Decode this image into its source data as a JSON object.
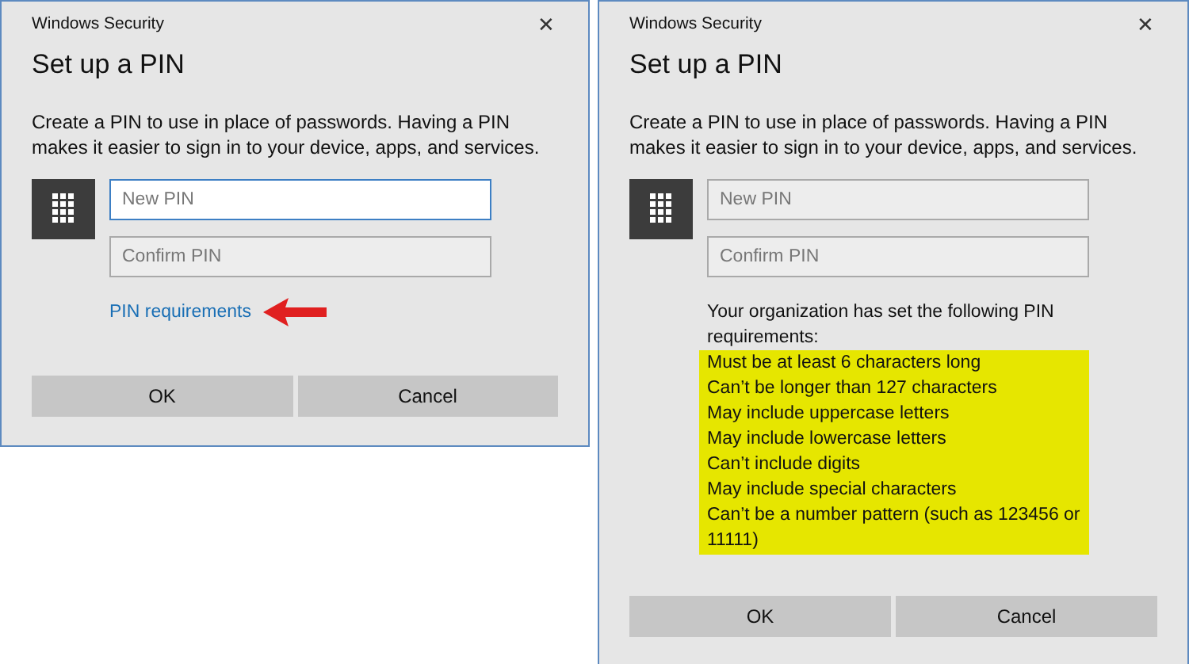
{
  "dialogs": [
    {
      "window_title": "Windows Security",
      "heading": "Set up a PIN",
      "description": "Create a PIN to use in place of passwords. Having a PIN makes it easier to sign in to your device, apps, and services.",
      "close": "✕",
      "fields": [
        {
          "placeholder": "New PIN",
          "focused": true
        },
        {
          "placeholder": "Confirm PIN",
          "focused": false
        }
      ],
      "link": {
        "label": "PIN requirements",
        "annotated": true
      },
      "buttons": [
        "OK",
        "Cancel"
      ]
    },
    {
      "window_title": "Windows Security",
      "heading": "Set up a PIN",
      "description": "Create a PIN to use in place of passwords. Having a PIN makes it easier to sign in to your device, apps, and services.",
      "close": "✕",
      "fields": [
        {
          "placeholder": "New PIN",
          "focused": false
        },
        {
          "placeholder": "Confirm PIN",
          "focused": false
        }
      ],
      "requirements": {
        "intro": "Your organization has set the following PIN requirements:",
        "highlighted": true,
        "items": [
          "Must be at least 6 characters long",
          "Can’t be longer than 127 characters",
          "May include uppercase letters",
          "May include lowercase letters",
          "Can’t include digits",
          "May include special characters",
          "Can’t be a number pattern (such as 123456 or 11111)"
        ]
      },
      "buttons": [
        "OK",
        "Cancel"
      ]
    }
  ]
}
